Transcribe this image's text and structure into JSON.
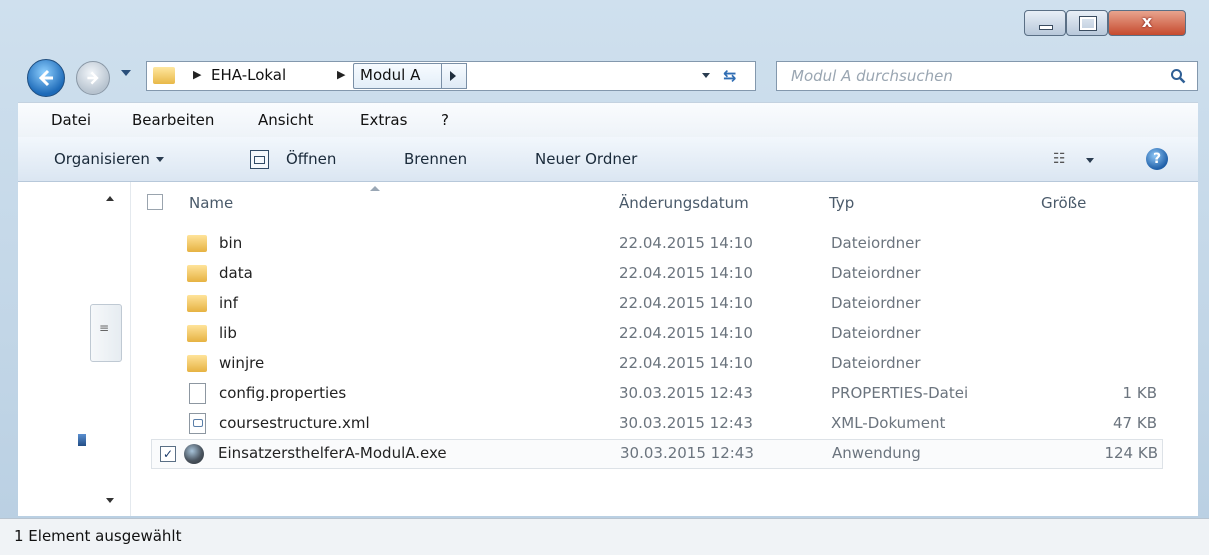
{
  "window": {
    "close_glyph": "x"
  },
  "nav": {
    "breadcrumb": [
      "EHA-Lokal",
      "Modul A"
    ],
    "search_placeholder": "Modul A durchsuchen"
  },
  "menubar": {
    "items": [
      "Datei",
      "Bearbeiten",
      "Ansicht",
      "Extras",
      "?"
    ]
  },
  "commandbar": {
    "organize": "Organisieren",
    "open": "Öffnen",
    "burn": "Brennen",
    "new_folder": "Neuer Ordner"
  },
  "columns": {
    "name": "Name",
    "date": "Änderungsdatum",
    "type": "Typ",
    "size": "Größe"
  },
  "files": [
    {
      "name": "bin",
      "date": "22.04.2015 14:10",
      "type": "Dateiordner",
      "size": "",
      "icon": "folder-icon"
    },
    {
      "name": "data",
      "date": "22.04.2015 14:10",
      "type": "Dateiordner",
      "size": "",
      "icon": "folder-icon"
    },
    {
      "name": "inf",
      "date": "22.04.2015 14:10",
      "type": "Dateiordner",
      "size": "",
      "icon": "folder-icon"
    },
    {
      "name": "lib",
      "date": "22.04.2015 14:10",
      "type": "Dateiordner",
      "size": "",
      "icon": "folder-icon"
    },
    {
      "name": "winjre",
      "date": "22.04.2015 14:10",
      "type": "Dateiordner",
      "size": "",
      "icon": "folder-icon"
    },
    {
      "name": "config.properties",
      "date": "30.03.2015 12:43",
      "type": "PROPERTIES-Datei",
      "size": "1 KB",
      "icon": "file-icon"
    },
    {
      "name": "coursestructure.xml",
      "date": "30.03.2015 12:43",
      "type": "XML-Dokument",
      "size": "47 KB",
      "icon": "xml-file-icon"
    },
    {
      "name": "EinsatzersthelferA-ModulA.exe",
      "date": "30.03.2015 12:43",
      "type": "Anwendung",
      "size": "124 KB",
      "icon": "application-icon",
      "selected": true
    }
  ],
  "status": {
    "text": "1 Element ausgewählt"
  }
}
